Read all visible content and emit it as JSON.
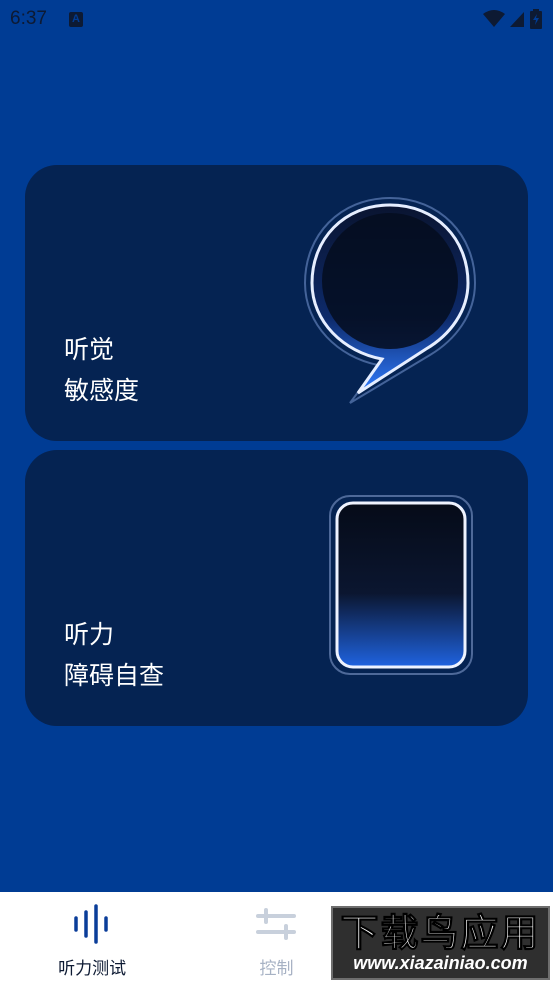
{
  "status_bar": {
    "time": "6:37",
    "notification_badge": "A",
    "icons": [
      "wifi-icon",
      "signal-icon",
      "battery-icon"
    ]
  },
  "cards": [
    {
      "title_line1": "听觉",
      "title_line2": "敏感度",
      "icon": "waveform-speech-bubble-icon"
    },
    {
      "title_line1": "听力",
      "title_line2": "障碍自查",
      "icon": "document-lines-icon"
    }
  ],
  "bottom_nav": {
    "items": [
      {
        "label": "听力测试",
        "icon": "sound-bars-icon",
        "active": true
      },
      {
        "label": "控制",
        "icon": "sliders-icon",
        "active": false
      },
      {
        "label": "",
        "icon": "more-icon",
        "active": false
      }
    ]
  },
  "watermark": {
    "big": "下载鸟应用",
    "small": "www.xiazainiao.com"
  },
  "colors": {
    "background": "#003c94",
    "card": "#052352",
    "accent": "#2f7bff",
    "nav_active": "#0d1a33",
    "nav_inactive": "#a7b2c4"
  }
}
